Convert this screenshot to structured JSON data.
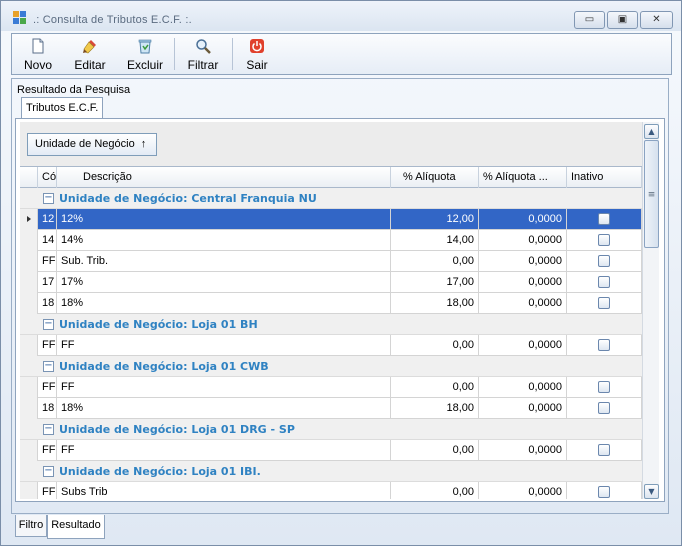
{
  "window": {
    "title": ".: Consulta de Tributos E.C.F. :.",
    "controls": {
      "minimize": "▭",
      "maximize": "▣",
      "close": "✕"
    }
  },
  "toolbar": {
    "buttons": [
      {
        "label": "Novo",
        "icon": "new-document-icon"
      },
      {
        "label": "Editar",
        "icon": "edit-brush-icon"
      },
      {
        "label": "Excluir",
        "icon": "delete-recycle-icon"
      },
      {
        "label": "Filtrar",
        "icon": "magnifier-icon"
      },
      {
        "label": "Sair",
        "icon": "power-exit-icon"
      }
    ]
  },
  "results": {
    "section_label": "Resultado da Pesquisa",
    "tab_label": "Tributos E.C.F.",
    "group_by_chip": "Unidade de Negócio",
    "group_by_arrow": "↑"
  },
  "grid": {
    "columns": [
      "Có...",
      "Descrição",
      "% Alíquota",
      "% Alíquota ...",
      "Inativo"
    ],
    "groups": [
      {
        "title": "Unidade de Negócio: Central Franquia NU",
        "rows": [
          {
            "code": "12",
            "desc": "12%",
            "aliquota": "12,00",
            "aliquota2": "0,0000",
            "inativo": false,
            "selected": true
          },
          {
            "code": "14",
            "desc": "14%",
            "aliquota": "14,00",
            "aliquota2": "0,0000",
            "inativo": false
          },
          {
            "code": "FF",
            "desc": "Sub. Trib.",
            "aliquota": "0,00",
            "aliquota2": "0,0000",
            "inativo": false
          },
          {
            "code": "17",
            "desc": "17%",
            "aliquota": "17,00",
            "aliquota2": "0,0000",
            "inativo": false
          },
          {
            "code": "18",
            "desc": "18%",
            "aliquota": "18,00",
            "aliquota2": "0,0000",
            "inativo": false
          }
        ]
      },
      {
        "title": "Unidade de Negócio: Loja 01 BH",
        "rows": [
          {
            "code": "FF",
            "desc": "FF",
            "aliquota": "0,00",
            "aliquota2": "0,0000",
            "inativo": false
          }
        ]
      },
      {
        "title": "Unidade de Negócio: Loja 01 CWB",
        "rows": [
          {
            "code": "FF",
            "desc": "FF",
            "aliquota": "0,00",
            "aliquota2": "0,0000",
            "inativo": false
          },
          {
            "code": "18",
            "desc": "18%",
            "aliquota": "18,00",
            "aliquota2": "0,0000",
            "inativo": false
          }
        ]
      },
      {
        "title": "Unidade de Negócio: Loja 01 DRG - SP",
        "rows": [
          {
            "code": "FF",
            "desc": "FF",
            "aliquota": "0,00",
            "aliquota2": "0,0000",
            "inativo": false
          }
        ]
      },
      {
        "title": "Unidade de Negócio: Loja 01 IBI.",
        "rows": [
          {
            "code": "FF",
            "desc": "Subs Trib",
            "aliquota": "0,00",
            "aliquota2": "0,0000",
            "inativo": false
          }
        ]
      }
    ],
    "group_toggle": "−"
  },
  "scrollbar": {
    "up": "▲",
    "down": "▼",
    "grip": "≡"
  },
  "bottom_tabs": [
    {
      "label": "Filtro"
    },
    {
      "label": "Resultado",
      "active": true
    }
  ],
  "colors": {
    "selection": "#3266c6",
    "group_title": "#2f82c2"
  }
}
